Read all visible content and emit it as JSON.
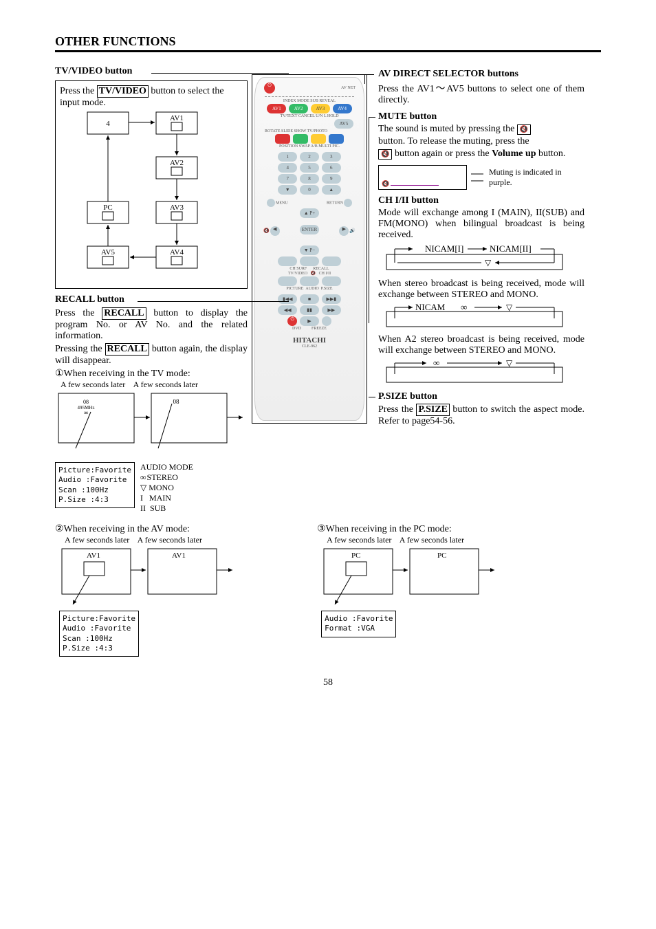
{
  "title": "OTHER FUNCTIONS",
  "page_number": "58",
  "tv_video": {
    "header": "TV/VIDEO button",
    "line1a": "Press the ",
    "line1_btn": "TV/VIDEO",
    "line1b": " button to select the input mode.",
    "nodes": {
      "n4": "4",
      "av1": "AV1",
      "av2": "AV2",
      "pc": "PC",
      "av3": "AV3",
      "av5": "AV5",
      "av4": "AV4"
    }
  },
  "recall": {
    "header": "RECALL button",
    "p1a": "Press the ",
    "p1_btn": "RECALL",
    "p1b": " button to display the program No. or AV No. and the related information.",
    "p2a": "Pressing the ",
    "p2_btn": "RECALL",
    "p2b": " button again, the display will disappear.",
    "item1": "①When receiving in the TV mode:",
    "few_seconds": "A few seconds later",
    "osd_lines": [
      "Picture:Favorite",
      "Audio  :Favorite",
      "Scan   :100Hz",
      "P.Size :4:3"
    ],
    "audiomode_title": "AUDIO MODE",
    "audiomode_items": [
      "STEREO",
      "MONO",
      "MAIN",
      "SUB"
    ],
    "audiomode_prefix": [
      "",
      "",
      "I",
      "II"
    ],
    "ch08": "08",
    "freq": "495MHz",
    "item2": "②When receiving in the AV mode:",
    "av_label": "AV1",
    "item3": "③When receiving in the PC mode:",
    "pc_label": "PC",
    "osd_pc": [
      "Audio  :Favorite",
      "Format :VGA"
    ]
  },
  "avdirect": {
    "header": "AV DIRECT SELECTOR buttons",
    "body": "Press the AV1～AV5 buttons to select one of them directly."
  },
  "mute": {
    "header": "MUTE button",
    "s1": "The sound is muted by pressing the ",
    "s2": "button. To release the muting, press the",
    "s3": " button again or press the ",
    "vol": "Volume up",
    "s4": " button.",
    "note": "Muting is indicated in purple.",
    "icon": "✕🔈"
  },
  "ch12": {
    "header": "CH I/II button",
    "body": "Mode will exchange among I (MAIN), II(SUB) and FM(MONO) when bilingual broadcast is being received.",
    "cyc1a": "NICAM[I]",
    "cyc1b": "NICAM[II]",
    "stereo1": "When stereo broadcast is being received, mode will exchange between STEREO and MONO.",
    "cyc2": "NICAM",
    "a2": "When A2 stereo broadcast is being received, mode will exchange between STEREO and MONO."
  },
  "psize": {
    "header": "P.SIZE button",
    "s1": "Press the ",
    "btn": "P.SIZE",
    "s2": " button to switch the aspect mode. Refer to page54-56."
  },
  "remote": {
    "brand": "HITACHI",
    "model": "CLE-962",
    "top_right": "AV NET",
    "row1": [
      "INDEX",
      "MODE",
      "SUB",
      "REVEAL"
    ],
    "row1b": [
      "AV1",
      "AV2",
      "AV3",
      "AV4"
    ],
    "row2a": [
      "TV/TEXT",
      "CANCEL",
      "U/N L",
      "HOLD"
    ],
    "row2b": [
      "",
      "",
      "",
      "AV5"
    ],
    "row3": [
      "ROTATE",
      "SLIDE SHOW",
      "TV/PHOTO",
      ""
    ],
    "row4lbl": [
      "POSITION",
      "SWAP",
      "A/B",
      "MULTI PIC."
    ],
    "nums": [
      "1",
      "2",
      "3",
      "4",
      "5",
      "6",
      "7",
      "8",
      "9",
      "0"
    ],
    "menu": "MENU",
    "return": "RETURN",
    "enter": "ENTER",
    "bottom1": [
      "CH SURF",
      "",
      "RECALL"
    ],
    "bottom2": [
      "TV/VIDEO",
      "",
      "CH I/II"
    ],
    "bottom3": [
      "PICTURE",
      "AUDIO",
      "P.SIZE"
    ],
    "dvd": "DVD",
    "freeze": "FREEZE"
  }
}
